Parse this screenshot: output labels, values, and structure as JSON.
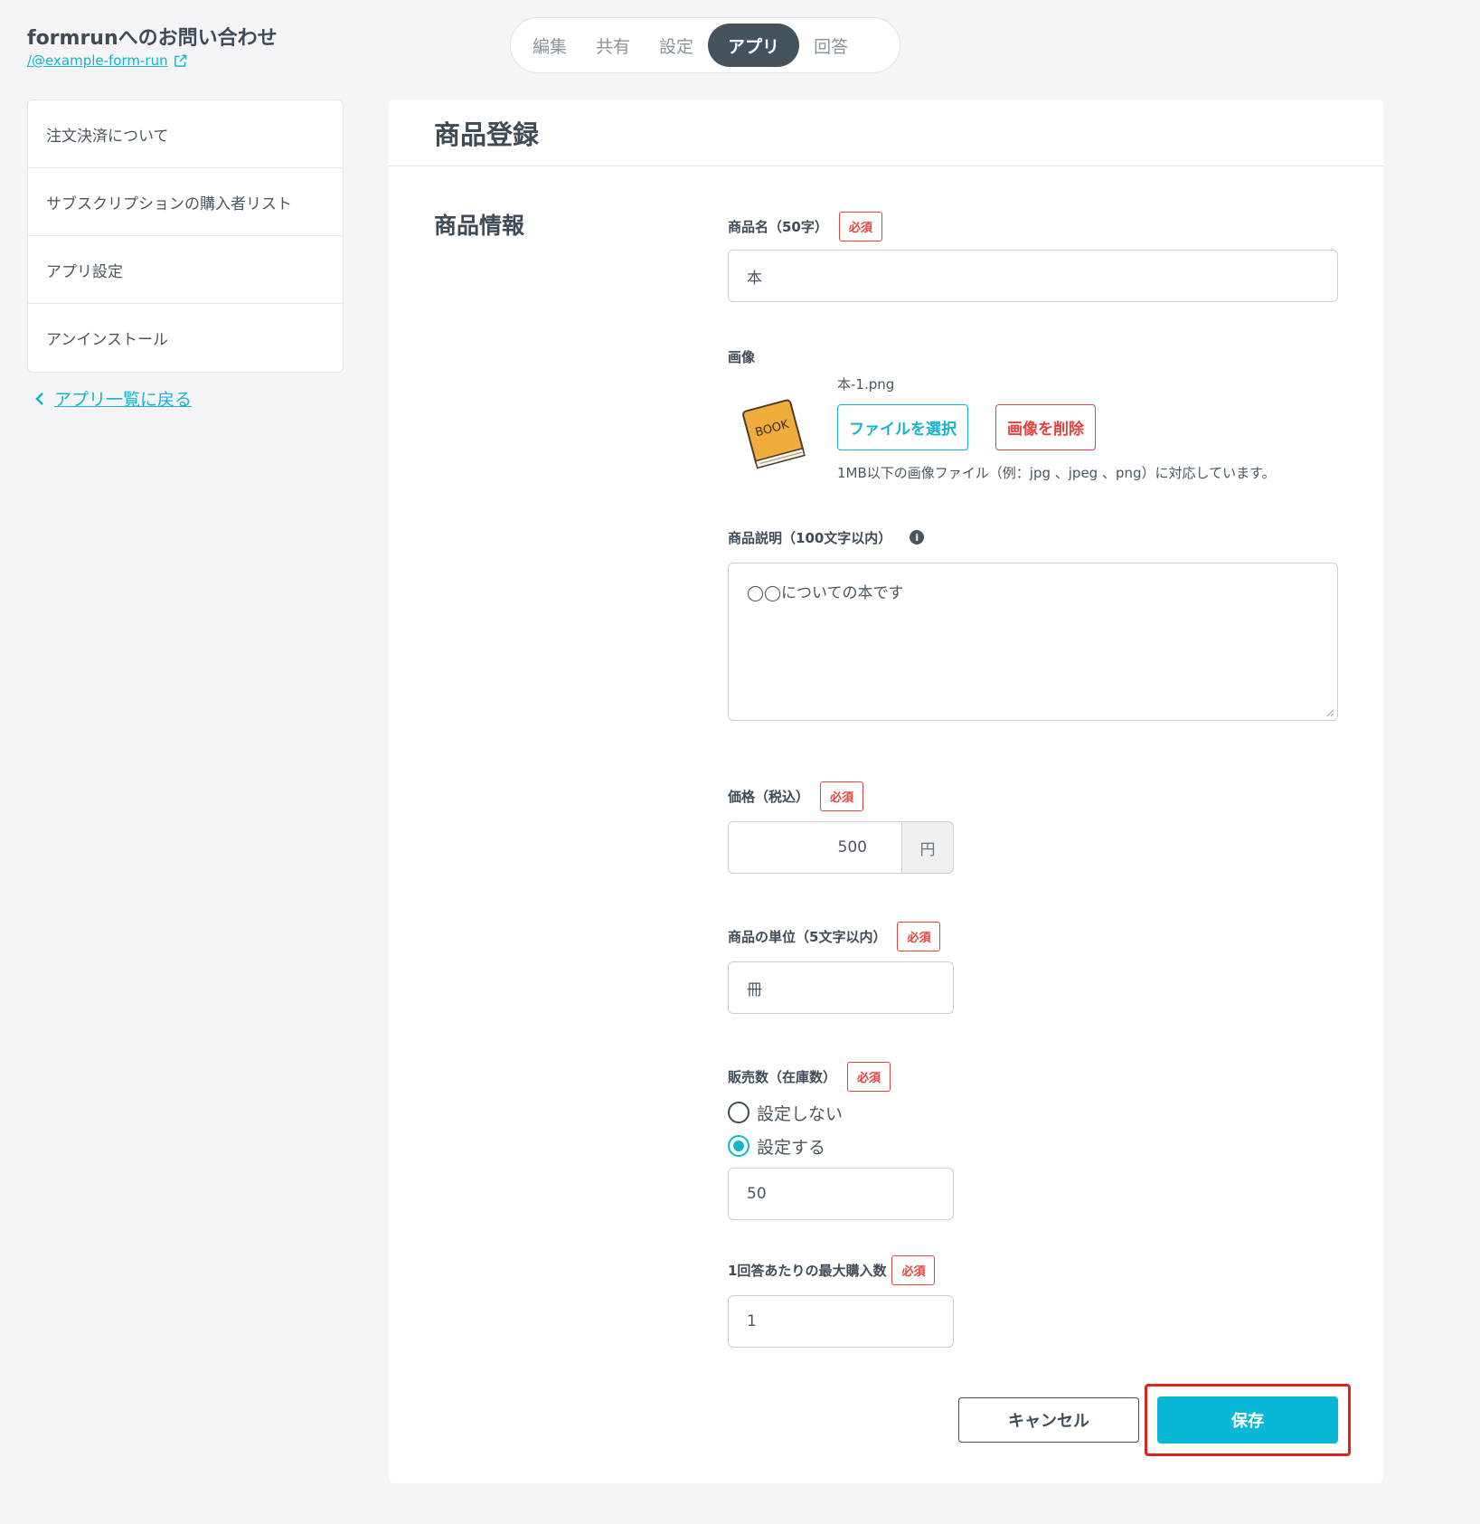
{
  "header": {
    "form_title": "formrunへのお問い合わせ",
    "form_link": "/@example-form-run"
  },
  "tabs": [
    {
      "label": "編集"
    },
    {
      "label": "共有"
    },
    {
      "label": "設定"
    },
    {
      "label": "アプリ",
      "active": true
    },
    {
      "label": "回答"
    }
  ],
  "sidebar": {
    "items": [
      {
        "label": "注文決済について"
      },
      {
        "label": "サブスクリプションの購入者リスト"
      },
      {
        "label": "アプリ設定"
      },
      {
        "label": "アンインストール"
      }
    ],
    "back_label": "アプリ一覧に戻る"
  },
  "panel": {
    "title": "商品登録",
    "section_title": "商品情報"
  },
  "fields": {
    "required_badge": "必須",
    "product_name": {
      "label": "商品名（50字）",
      "value": "本"
    },
    "image": {
      "label": "画像",
      "filename": "本-1.png",
      "select_button": "ファイルを選択",
      "delete_button": "画像を削除",
      "hint": "1MB以下の画像ファイル（例：jpg 、jpeg 、png）に対応しています。",
      "thumb_text": "BOOK"
    },
    "description": {
      "label": "商品説明（100文字以内）",
      "value": "◯◯についての本です",
      "info_icon": "i"
    },
    "price": {
      "label": "価格（税込）",
      "value": "500",
      "unit": "円"
    },
    "unit": {
      "label": "商品の単位（5文字以内）",
      "value": "冊"
    },
    "stock": {
      "label": "販売数（在庫数）",
      "options": [
        {
          "label": "設定しない",
          "checked": false
        },
        {
          "label": "設定する",
          "checked": true
        }
      ],
      "value": "50"
    },
    "max_purchase": {
      "label": "1回答あたりの最大購入数",
      "value": "1"
    }
  },
  "actions": {
    "cancel": "キャンセル",
    "save": "保存"
  },
  "colors": {
    "accent": "#0bb7d6",
    "required": "#e5423e",
    "highlight": "#d9271d",
    "active_tab": "#45535d"
  }
}
